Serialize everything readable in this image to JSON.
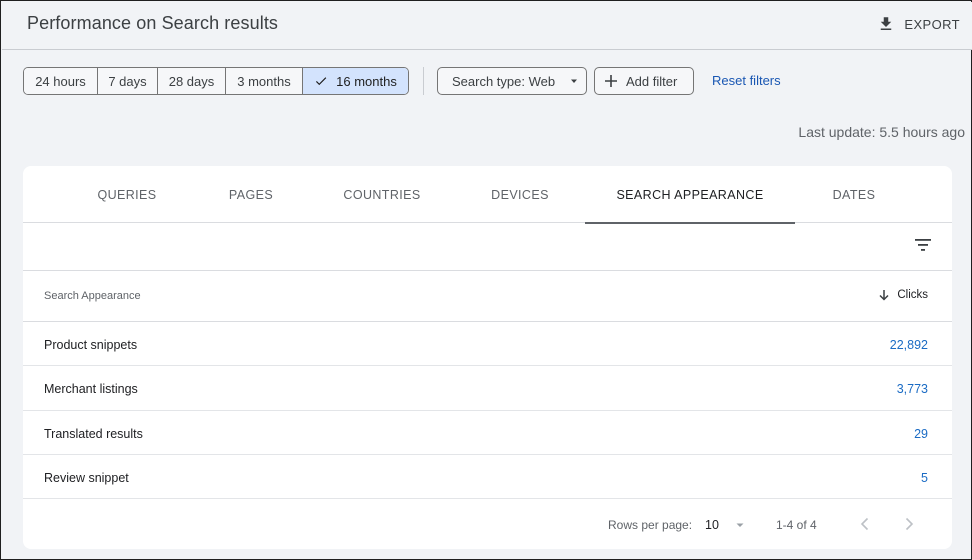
{
  "header": {
    "title": "Performance on Search results",
    "export_label": "EXPORT"
  },
  "date_range": {
    "options": [
      "24 hours",
      "7 days",
      "28 days",
      "3 months",
      "16 months"
    ],
    "selected": "16 months"
  },
  "filters": {
    "search_type_label": "Search type: Web",
    "add_filter_label": "Add filter",
    "reset_label": "Reset filters"
  },
  "last_update": "Last update: 5.5 hours ago",
  "tabs": [
    {
      "label": "QUERIES",
      "active": false
    },
    {
      "label": "PAGES",
      "active": false
    },
    {
      "label": "COUNTRIES",
      "active": false
    },
    {
      "label": "DEVICES",
      "active": false
    },
    {
      "label": "SEARCH APPEARANCE",
      "active": true
    },
    {
      "label": "DATES",
      "active": false
    }
  ],
  "table": {
    "columns": [
      "Search Appearance",
      "Clicks"
    ],
    "rows": [
      {
        "name": "Product snippets",
        "clicks": "22,892"
      },
      {
        "name": "Merchant listings",
        "clicks": "3,773"
      },
      {
        "name": "Translated results",
        "clicks": "29"
      },
      {
        "name": "Review snippet",
        "clicks": "5"
      }
    ]
  },
  "pagination": {
    "rows_per_page_label": "Rows per page:",
    "rows_per_page": "10",
    "range": "1-4 of 4"
  },
  "icons": {
    "export": "download-icon",
    "selected_check": "check-icon",
    "dropdown": "caret-down-icon",
    "add": "plus-icon",
    "filter": "filter-list-icon",
    "sort": "arrow-down-icon",
    "prev": "chevron-left-icon",
    "next": "chevron-right-icon"
  },
  "colors": {
    "background": "#f1f3f6",
    "selected_chip": "#d3e3fd",
    "link": "#1a57b3",
    "value_link": "#1a6bc4"
  }
}
